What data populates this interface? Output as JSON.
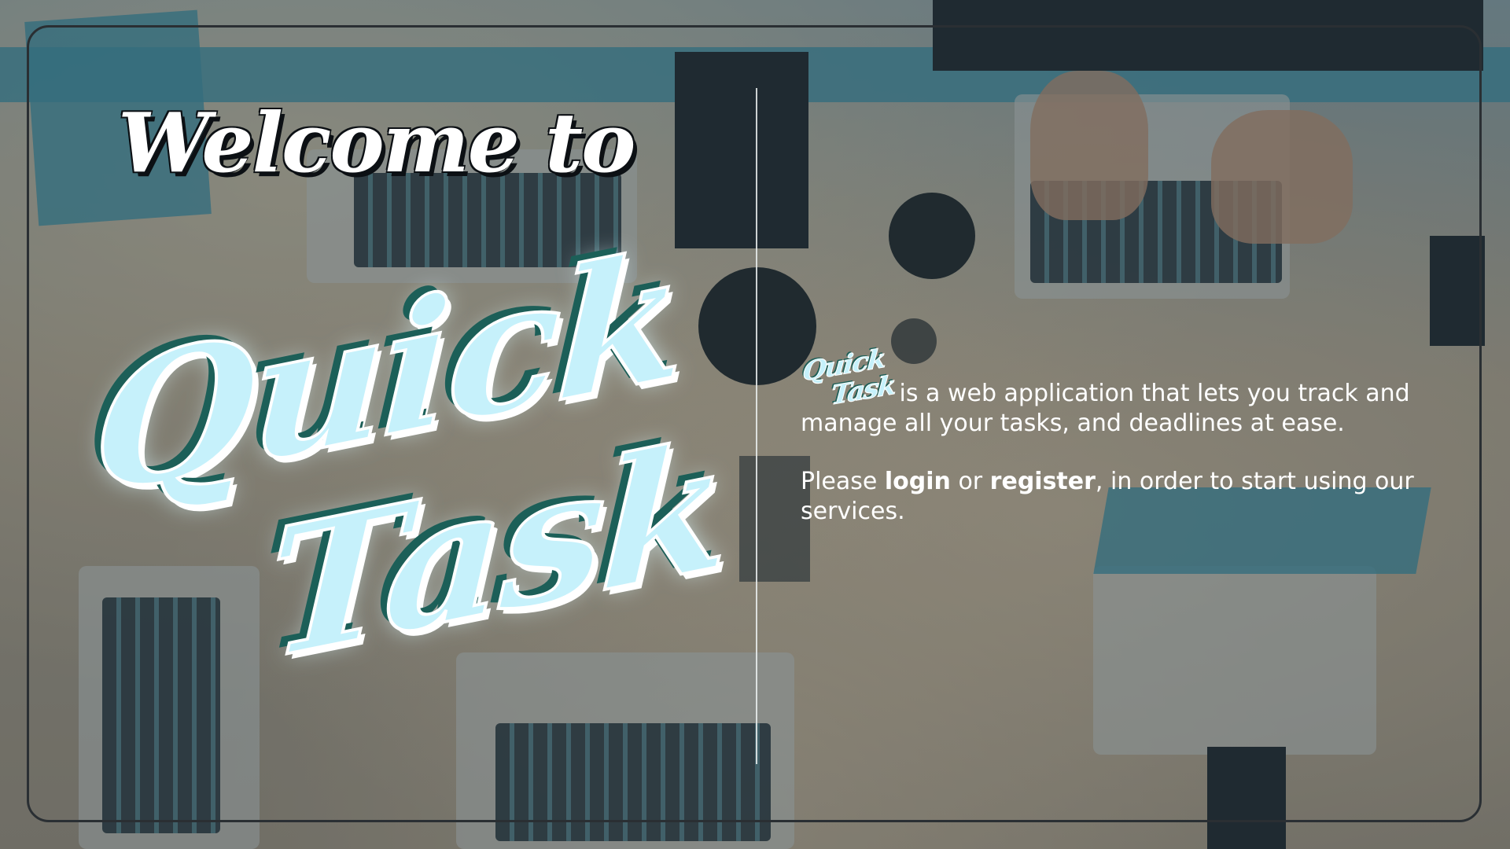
{
  "hero": {
    "welcome": "Welcome to",
    "logo_line1": "Quick",
    "logo_line2": "Task"
  },
  "intro": {
    "logo_line1": "Quick",
    "logo_line2": "Task",
    "description": "is a web application that lets you track and manage all your tasks, and deadlines at ease.",
    "cta_prefix": "Please ",
    "login_label": "login",
    "cta_or": " or ",
    "register_label": "register",
    "cta_suffix": ", in order to start using our services."
  },
  "colors": {
    "logo_fill": "#c6f1fb",
    "logo_outline": "#1c5f58",
    "frame": "#2a2f33",
    "text": "#ffffff"
  }
}
